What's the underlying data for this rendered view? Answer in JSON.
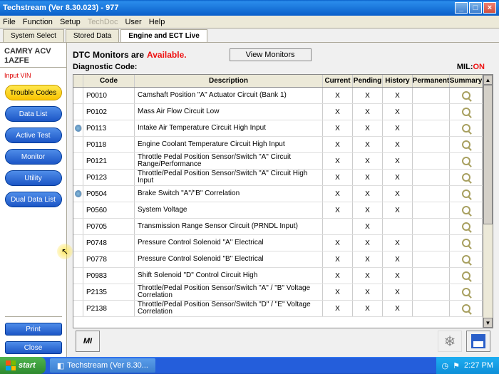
{
  "window": {
    "title": "Techstream (Ver 8.30.023) - 977"
  },
  "menu": {
    "file": "File",
    "function": "Function",
    "setup": "Setup",
    "techdoc": "TechDoc",
    "user": "User",
    "help": "Help"
  },
  "tabs": {
    "system_select": "System Select",
    "stored_data": "Stored Data",
    "engine_ect": "Engine and ECT Live"
  },
  "vehicle": {
    "line1": "CAMRY ACV",
    "line2": "1AZFE",
    "input_vin": "Input VIN"
  },
  "nav": {
    "trouble_codes": "Trouble Codes",
    "data_list": "Data List",
    "active_test": "Active Test",
    "monitor": "Monitor",
    "utility": "Utility",
    "dual_data": "Dual Data List",
    "print": "Print",
    "close": "Close"
  },
  "header": {
    "dtc_monitors": "DTC Monitors are",
    "available": "Available.",
    "view_monitors": "View Monitors",
    "diag_code": "Diagnostic Code:",
    "mil": "MIL:",
    "mil_state": "ON"
  },
  "columns": {
    "code": "Code",
    "desc": "Description",
    "current": "Current",
    "pending": "Pending",
    "history": "History",
    "permanent": "Permanent",
    "summary": "Summary"
  },
  "rows": [
    {
      "icon": false,
      "code": "P0010",
      "desc": "Camshaft Position \"A\" Actuator Circuit (Bank 1)",
      "cur": "X",
      "pen": "X",
      "his": "X",
      "perm": ""
    },
    {
      "icon": false,
      "code": "P0102",
      "desc": "Mass Air Flow Circuit Low",
      "cur": "X",
      "pen": "X",
      "his": "X",
      "perm": ""
    },
    {
      "icon": true,
      "code": "P0113",
      "desc": "Intake Air Temperature Circuit High Input",
      "cur": "X",
      "pen": "X",
      "his": "X",
      "perm": ""
    },
    {
      "icon": false,
      "code": "P0118",
      "desc": "Engine Coolant Temperature Circuit High Input",
      "cur": "X",
      "pen": "X",
      "his": "X",
      "perm": ""
    },
    {
      "icon": false,
      "code": "P0121",
      "desc": "Throttle Pedal Position Sensor/Switch \"A\" Circuit Range/Performance",
      "cur": "X",
      "pen": "X",
      "his": "X",
      "perm": ""
    },
    {
      "icon": false,
      "code": "P0123",
      "desc": "Throttle/Pedal Position Sensor/Switch \"A\" Circuit High Input",
      "cur": "X",
      "pen": "X",
      "his": "X",
      "perm": ""
    },
    {
      "icon": true,
      "code": "P0504",
      "desc": "Brake Switch \"A\"/\"B\" Correlation",
      "cur": "X",
      "pen": "X",
      "his": "X",
      "perm": ""
    },
    {
      "icon": false,
      "code": "P0560",
      "desc": "System Voltage",
      "cur": "X",
      "pen": "X",
      "his": "X",
      "perm": ""
    },
    {
      "icon": false,
      "code": "P0705",
      "desc": "Transmission Range Sensor Circuit (PRNDL Input)",
      "cur": "",
      "pen": "X",
      "his": "",
      "perm": ""
    },
    {
      "icon": false,
      "code": "P0748",
      "desc": "Pressure Control Solenoid \"A\" Electrical",
      "cur": "X",
      "pen": "X",
      "his": "X",
      "perm": ""
    },
    {
      "icon": false,
      "code": "P0778",
      "desc": "Pressure Control Solenoid \"B\" Electrical",
      "cur": "X",
      "pen": "X",
      "his": "X",
      "perm": ""
    },
    {
      "icon": false,
      "code": "P0983",
      "desc": "Shift Solenoid \"D\" Control Circuit High",
      "cur": "X",
      "pen": "X",
      "his": "X",
      "perm": ""
    },
    {
      "icon": false,
      "code": "P2135",
      "desc": "Throttle/Pedal Position Sensor/Switch \"A\" / \"B\" Voltage Correlation",
      "cur": "X",
      "pen": "X",
      "his": "X",
      "perm": ""
    },
    {
      "icon": false,
      "code": "P2138",
      "desc": "Throttle/Pedal Position Sensor/Switch \"D\" / \"E\" Voltage Correlation",
      "cur": "X",
      "pen": "X",
      "his": "X",
      "perm": ""
    }
  ],
  "taskbar": {
    "start": "start",
    "app": "Techstream (Ver 8.30...",
    "clock": "2:27 PM"
  }
}
